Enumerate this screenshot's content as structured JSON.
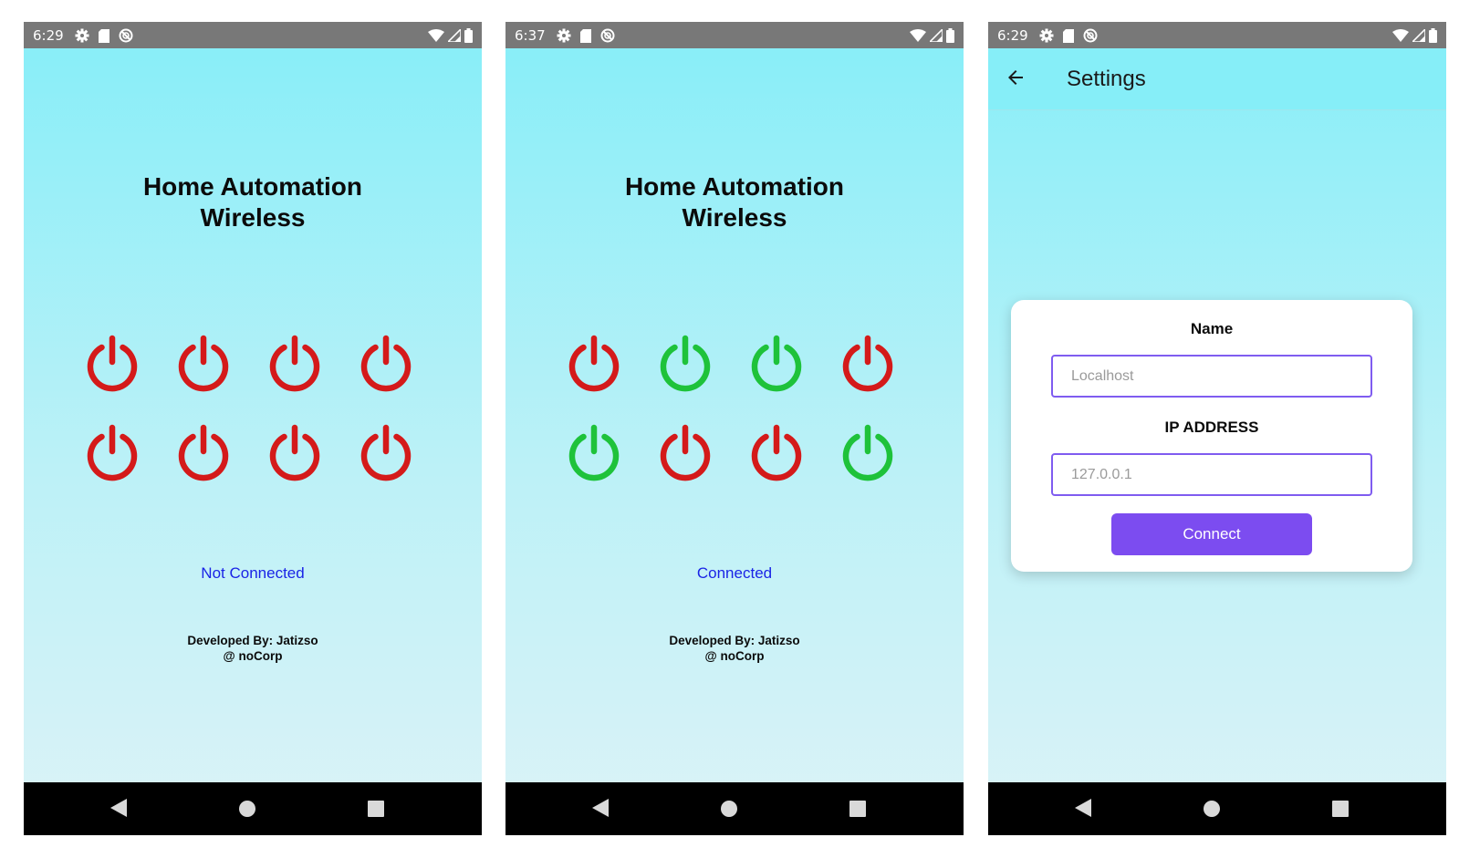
{
  "colors": {
    "statusbar": "#787878",
    "navbar": "#000000",
    "background_top": "#86eef8",
    "background_bottom": "#dcf3f7",
    "power_off": "#d41a1a",
    "power_on": "#1ec23a",
    "status_text": "#1a24e6",
    "accent": "#7c4cf0"
  },
  "screens": [
    {
      "statusbar": {
        "time": "6:29",
        "left_icons": [
          "settings-gear-icon",
          "sd-card-icon",
          "do-not-disturb-icon"
        ],
        "right_icons": [
          "wifi-icon",
          "signal-icon",
          "battery-icon"
        ]
      },
      "title_line1": "Home Automation",
      "title_line2": "Wireless",
      "switches": [
        {
          "id": 1,
          "state": "off"
        },
        {
          "id": 2,
          "state": "off"
        },
        {
          "id": 3,
          "state": "off"
        },
        {
          "id": 4,
          "state": "off"
        },
        {
          "id": 5,
          "state": "off"
        },
        {
          "id": 6,
          "state": "off"
        },
        {
          "id": 7,
          "state": "off"
        },
        {
          "id": 8,
          "state": "off"
        }
      ],
      "connection_status": "Not Connected",
      "credits_line1": "Developed By: Jatizso",
      "credits_line2": "@ noCorp",
      "navbar": [
        "back-triangle-icon",
        "home-circle-icon",
        "recents-square-icon"
      ]
    },
    {
      "statusbar": {
        "time": "6:37",
        "left_icons": [
          "settings-gear-icon",
          "sd-card-icon",
          "do-not-disturb-icon"
        ],
        "right_icons": [
          "wifi-icon",
          "signal-icon",
          "battery-icon"
        ]
      },
      "title_line1": "Home Automation",
      "title_line2": "Wireless",
      "switches": [
        {
          "id": 1,
          "state": "off"
        },
        {
          "id": 2,
          "state": "on"
        },
        {
          "id": 3,
          "state": "on"
        },
        {
          "id": 4,
          "state": "off"
        },
        {
          "id": 5,
          "state": "on"
        },
        {
          "id": 6,
          "state": "off"
        },
        {
          "id": 7,
          "state": "off"
        },
        {
          "id": 8,
          "state": "on"
        }
      ],
      "connection_status": "Connected",
      "credits_line1": "Developed By: Jatizso",
      "credits_line2": "@ noCorp",
      "navbar": [
        "back-triangle-icon",
        "home-circle-icon",
        "recents-square-icon"
      ]
    },
    {
      "statusbar": {
        "time": "6:29",
        "left_icons": [
          "settings-gear-icon",
          "sd-card-icon",
          "do-not-disturb-icon"
        ],
        "right_icons": [
          "wifi-icon",
          "signal-icon",
          "battery-icon"
        ]
      },
      "appbar": {
        "back_icon": "arrow-left-icon",
        "title": "Settings"
      },
      "form": {
        "name_label": "Name",
        "name_placeholder": "Localhost",
        "name_value": "",
        "ip_label": "IP ADDRESS",
        "ip_placeholder": "127.0.0.1",
        "ip_value": "",
        "connect_label": "Connect"
      },
      "navbar": [
        "back-triangle-icon",
        "home-circle-icon",
        "recents-square-icon"
      ]
    }
  ]
}
